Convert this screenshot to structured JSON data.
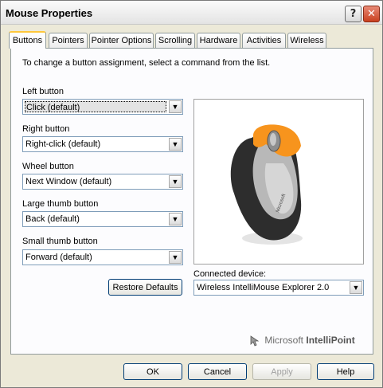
{
  "window": {
    "title": "Mouse Properties",
    "help_glyph": "?",
    "close_glyph": "✕"
  },
  "tabs": [
    {
      "label": "Buttons",
      "active": true
    },
    {
      "label": "Pointers"
    },
    {
      "label": "Pointer Options"
    },
    {
      "label": "Scrolling"
    },
    {
      "label": "Hardware"
    },
    {
      "label": "Activities"
    },
    {
      "label": "Wireless"
    }
  ],
  "buttons_tab": {
    "instruction": "To change a button assignment, select a command from the list.",
    "assignments": [
      {
        "label": "Left button",
        "value": "Click (default)"
      },
      {
        "label": "Right button",
        "value": "Right-click (default)"
      },
      {
        "label": "Wheel button",
        "value": "Next Window (default)"
      },
      {
        "label": "Large thumb button",
        "value": "Back (default)"
      },
      {
        "label": "Small thumb button",
        "value": "Forward (default)"
      }
    ],
    "restore_defaults": "Restore Defaults",
    "connected_device_label": "Connected device:",
    "connected_device_value": "Wireless IntelliMouse Explorer 2.0",
    "device_image": "wireless-mouse-illustration",
    "mouse_brand_text": "Microsoft"
  },
  "branding": {
    "company": "Microsoft",
    "product": "IntelliPoint",
    "icon": "mouse-cursor-icon"
  },
  "footer": {
    "ok": "OK",
    "cancel": "Cancel",
    "apply": "Apply",
    "help": "Help"
  },
  "colors": {
    "accent_tab": "#ffc83c",
    "mouse_orange": "#f7941d",
    "close_red": "#c9401f"
  }
}
